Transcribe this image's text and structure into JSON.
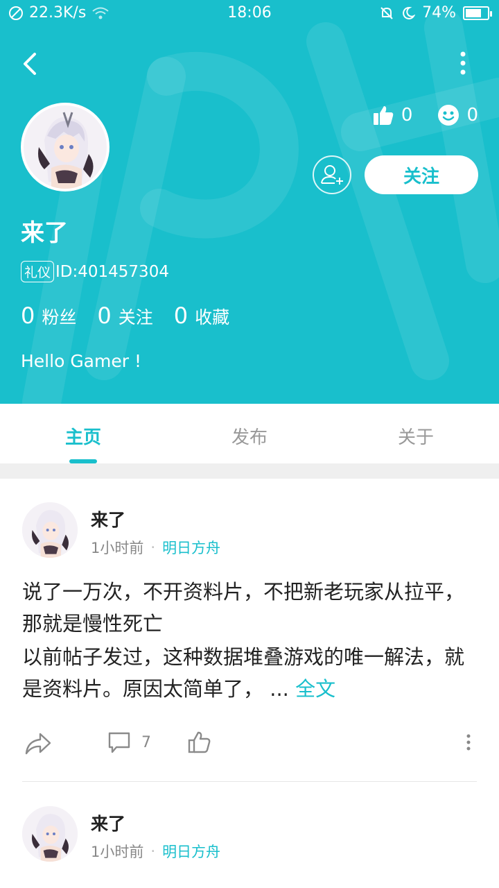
{
  "status_bar": {
    "net_speed": "22.3K/s",
    "time": "18:06",
    "battery": "74%",
    "battery_level": 0.74
  },
  "profile": {
    "username": "来了",
    "badge": "礼仪",
    "id_text": "ID:401457304",
    "likes": "0",
    "emotes": "0",
    "follow_label": "关注",
    "counts": [
      {
        "num": "0",
        "label": "粉丝"
      },
      {
        "num": "0",
        "label": "关注"
      },
      {
        "num": "0",
        "label": "收藏"
      }
    ],
    "bio": "Hello Gamer !"
  },
  "tabs": [
    {
      "label": "主页",
      "active": true
    },
    {
      "label": "发布",
      "active": false
    },
    {
      "label": "关于",
      "active": false
    }
  ],
  "posts": [
    {
      "author": "来了",
      "time": "1小时前",
      "dot": "·",
      "game": "明日方舟",
      "para1": "说了一万次，不开资料片，不把新老玩家从拉平，那就是慢性死亡",
      "para2": "以前帖子发过，这种数据堆叠游戏的唯一解法，就是资料片。原因太简单了，",
      "ellipsis": " ... ",
      "more": "全文",
      "comments": "7"
    },
    {
      "author": "来了",
      "time": "1小时前",
      "dot": "·",
      "game": "明日方舟"
    }
  ],
  "colors": {
    "accent": "#19bfcc"
  },
  "icons": [
    "back-icon",
    "more-vertical-icon",
    "thumb-up-icon",
    "smile-icon",
    "add-friend-icon",
    "share-icon",
    "comment-icon",
    "like-icon"
  ]
}
